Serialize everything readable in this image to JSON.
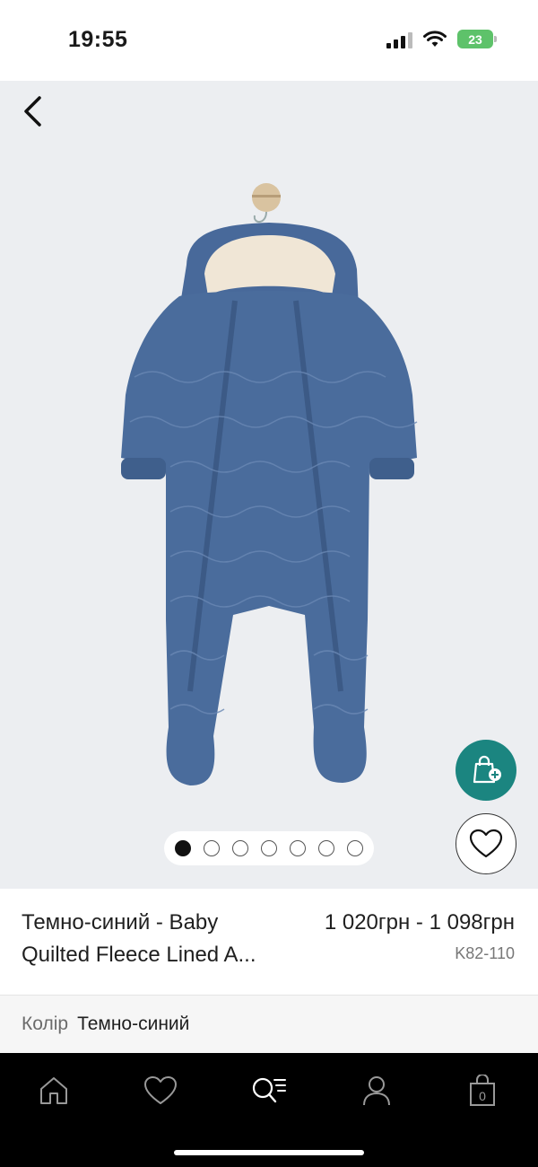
{
  "status_bar": {
    "time": "19:55",
    "battery": "23"
  },
  "gallery": {
    "image_count": 7,
    "active_index": 0,
    "colors": {
      "background": "#eceef1",
      "garment": "#4a6c9c",
      "lining": "#f0e6d6",
      "cart_button": "#1b8580"
    }
  },
  "product": {
    "title_line1": "Темно-синий - Baby",
    "title_line2": "Quilted Fleece Lined A...",
    "price": "1 020грн - 1 098грн",
    "sku": "K82-110"
  },
  "color_row": {
    "label": "Колір",
    "value": "Темно-синий"
  },
  "bottom_nav": {
    "cart_count": "0",
    "items": [
      "home-icon",
      "heart-icon",
      "search-icon",
      "account-icon",
      "bag-icon"
    ]
  }
}
